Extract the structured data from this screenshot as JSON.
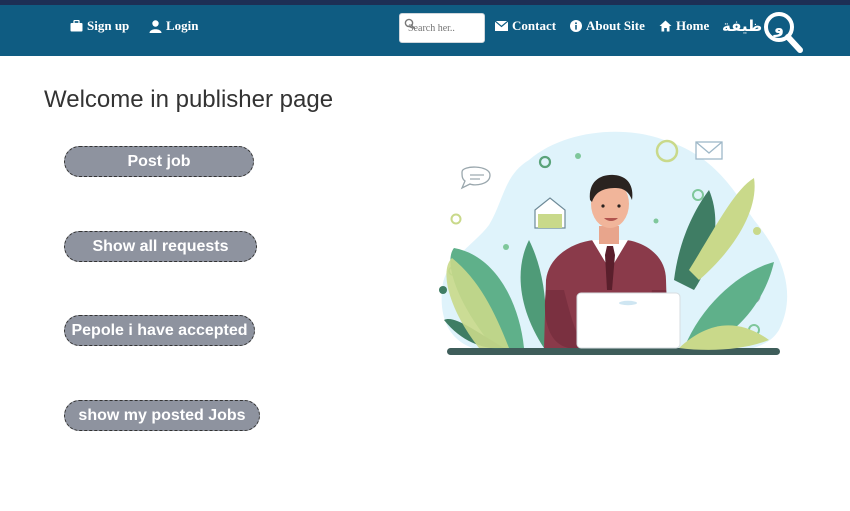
{
  "nav": {
    "signup_label": "Sign up",
    "login_label": "Login",
    "search_placeholder": "Search her..",
    "contact_label": "Contact",
    "about_label": "About Site",
    "home_label": "Home",
    "logo_text": "ظيفة",
    "logo_letter": "و"
  },
  "main": {
    "title": "Welcome in publisher page",
    "buttons": {
      "post_job": "Post job",
      "show_requests": "Show all requests",
      "accepted": "Pepole i have accepted",
      "posted_jobs": "show my posted Jobs"
    }
  },
  "colors": {
    "navbar": "#0f5c82",
    "top_strip": "#1d2f55",
    "button_bg": "#8e939f"
  }
}
